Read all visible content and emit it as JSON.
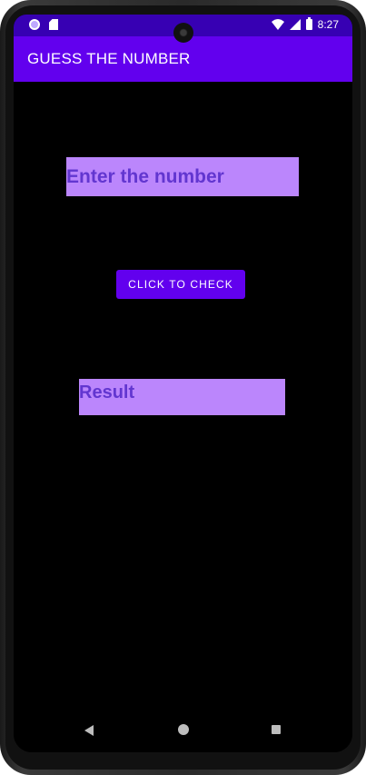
{
  "status_bar": {
    "time": "8:27",
    "icons": [
      "status-dot-icon",
      "sd-card-icon",
      "wifi-icon",
      "signal-icon",
      "battery-icon"
    ]
  },
  "app_bar": {
    "title": "GUESS THE NUMBER"
  },
  "main": {
    "number_input": {
      "placeholder": "Enter the number",
      "value": ""
    },
    "check_button_label": "CLICK TO CHECK",
    "result_label": "Result"
  },
  "nav_bar": {
    "icons": [
      "back-icon",
      "home-icon",
      "recents-icon"
    ]
  },
  "colors": {
    "primary": "#6200ee",
    "primary_dark": "#3700b3",
    "accent_field": "#bb86fc",
    "field_text": "#6236d0",
    "background": "#000000"
  }
}
